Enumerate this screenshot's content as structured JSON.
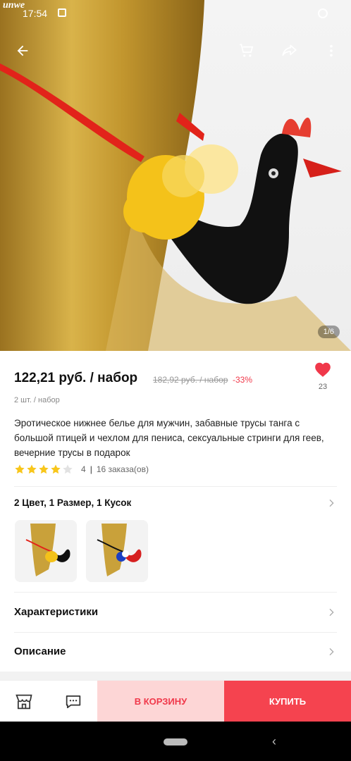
{
  "status_bar": {
    "brand": "unwe",
    "time": "17:54"
  },
  "hero": {
    "image_counter": "1/6"
  },
  "product": {
    "price": "122,21 руб. / набор",
    "old_price": "182,92 руб. / набор",
    "discount": "-33%",
    "favorites_count": "23",
    "unit": "2 шт. / набор",
    "title": "Эротическое нижнее белье для мужчин, забавные трусы танга с большой птицей и чехлом для пениса, сексуальные стринги для геев, вечерние трусы в подарок",
    "rating": "4",
    "rating_stars": 4,
    "orders": "16 заказа(ов)"
  },
  "variants": {
    "label": "2 Цвет, 1 Размер, 1 Кусок"
  },
  "sections": {
    "specs": "Характеристики",
    "description": "Описание"
  },
  "bottom_bar": {
    "add_to_cart": "В КОРЗИНУ",
    "buy": "КУПИТЬ"
  },
  "colors": {
    "accent": "#f0384a",
    "cart_bg": "#fdd6d6",
    "buy_bg": "#f5434f",
    "star": "#f8c61b"
  },
  "icons": [
    "back-arrow-icon",
    "cart-icon",
    "share-icon",
    "more-icon",
    "heart-icon",
    "star-icon",
    "chevron-right-icon",
    "store-icon",
    "chat-icon"
  ]
}
